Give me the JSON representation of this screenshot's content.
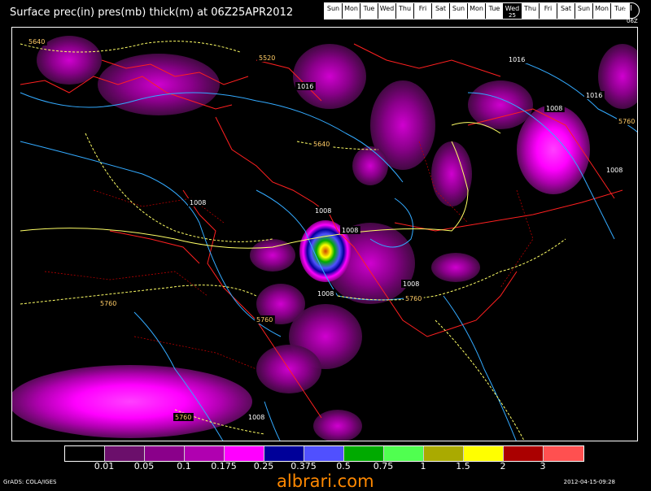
{
  "title": "Surface prec(in) pres(mb) thick(m) at 06Z25APR2012",
  "days": [
    {
      "name": "Sun"
    },
    {
      "name": "Mon"
    },
    {
      "name": "Tue"
    },
    {
      "name": "Wed"
    },
    {
      "name": "Thu"
    },
    {
      "name": "Fri"
    },
    {
      "name": "Sat"
    },
    {
      "name": "Sun"
    },
    {
      "name": "Mon"
    },
    {
      "name": "Tue"
    },
    {
      "name": "Wed",
      "date": "25",
      "active": true
    },
    {
      "name": "Thu"
    },
    {
      "name": "Fri"
    },
    {
      "name": "Sat"
    },
    {
      "name": "Sun"
    },
    {
      "name": "Mon"
    },
    {
      "name": "Tue"
    }
  ],
  "clock_label": "06Z",
  "colorbar": {
    "colors": [
      "#000000",
      "#6b0f6b",
      "#8a008a",
      "#b000b0",
      "#ff00ff",
      "#000099",
      "#5050ff",
      "#00aa00",
      "#50ff50",
      "#aaaa00",
      "#ffff00",
      "#aa0000",
      "#ff5050"
    ],
    "labels": [
      "0.01",
      "0.05",
      "0.1",
      "0.175",
      "0.25",
      "0.375",
      "0.5",
      "0.75",
      "1",
      "1.5",
      "2",
      "3"
    ]
  },
  "contour_labels": {
    "pressure": [
      "1016",
      "1016",
      "1016",
      "1008",
      "1008",
      "1008",
      "1008",
      "1008",
      "1008",
      "1008",
      "1008"
    ],
    "thickness": [
      "5640",
      "5520",
      "5640",
      "5760",
      "5760",
      "5760",
      "5760",
      "5760"
    ]
  },
  "footer": {
    "left": "GrADS: COLA/IGES",
    "mid": "albrari.com",
    "right": "2012-04-15-09:28"
  }
}
